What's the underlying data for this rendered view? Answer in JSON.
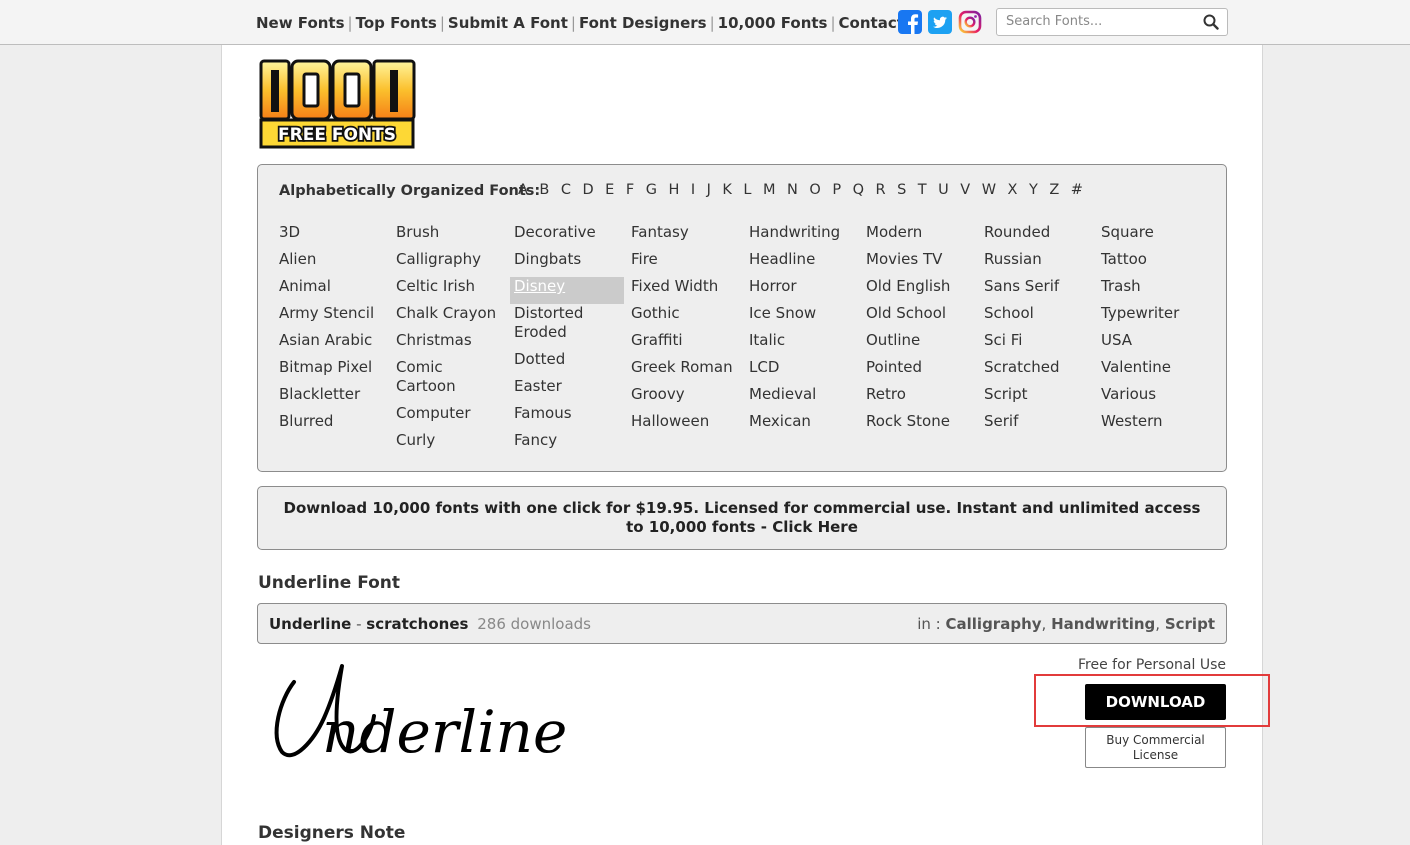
{
  "nav": {
    "links": [
      "New Fonts",
      "Top Fonts",
      "Submit A Font",
      "Font Designers",
      "10,000 Fonts",
      "Contact"
    ]
  },
  "social": {
    "facebook_color": "#1877f2",
    "twitter_color": "#1da1f2",
    "icons": [
      "facebook-icon",
      "twitter-icon",
      "instagram-icon"
    ]
  },
  "search": {
    "placeholder": "Search Fonts..."
  },
  "logo": {
    "top_text": "1001",
    "bottom_text": "FREE FONTS"
  },
  "categories": {
    "title": "Alphabetically Organized Fonts:",
    "letters": [
      "A",
      "B",
      "C",
      "D",
      "E",
      "F",
      "G",
      "H",
      "I",
      "J",
      "K",
      "L",
      "M",
      "N",
      "O",
      "P",
      "Q",
      "R",
      "S",
      "T",
      "U",
      "V",
      "W",
      "X",
      "Y",
      "Z",
      "#"
    ],
    "columns": [
      [
        "3D",
        "Alien",
        "Animal",
        "Army Stencil",
        "Asian Arabic",
        "Bitmap Pixel",
        "Blackletter",
        "Blurred"
      ],
      [
        "Brush",
        "Calligraphy",
        "Celtic Irish",
        "Chalk Crayon",
        "Christmas",
        "Comic Cartoon",
        "Computer",
        "Curly"
      ],
      [
        "Decorative",
        "Dingbats",
        "Disney",
        "Distorted Eroded",
        "Dotted",
        "Easter",
        "Famous",
        "Fancy"
      ],
      [
        "Fantasy",
        "Fire",
        "Fixed Width",
        "Gothic",
        "Graffiti",
        "Greek Roman",
        "Groovy",
        "Halloween"
      ],
      [
        "Handwriting",
        "Headline",
        "Horror",
        "Ice Snow",
        "Italic",
        "LCD",
        "Medieval",
        "Mexican"
      ],
      [
        "Modern",
        "Movies TV",
        "Old English",
        "Old School",
        "Outline",
        "Pointed",
        "Retro",
        "Rock Stone"
      ],
      [
        "Rounded",
        "Russian",
        "Sans Serif",
        "School",
        "Sci Fi",
        "Scratched",
        "Script",
        "Serif"
      ],
      [
        "Square",
        "Tattoo",
        "Trash",
        "Typewriter",
        "USA",
        "Valentine",
        "Various",
        "Western"
      ]
    ],
    "active": "Disney"
  },
  "promo": {
    "text": "Download 10,000 fonts with one click for $19.95. Licensed for commercial use. Instant and unlimited access to 10,000 fonts - Click Here"
  },
  "font": {
    "page_title": "Underline Font",
    "name": "Underline",
    "designer": "scratchones",
    "downloads": "286 downloads",
    "in_label": "in :",
    "tags": [
      "Calligraphy",
      "Handwriting",
      "Script"
    ],
    "preview_text": "Underline",
    "license": "Free for Personal Use",
    "download_label": "DOWNLOAD",
    "buy_label": "Buy Commercial License"
  },
  "designers_note": {
    "title": "Designers Note"
  },
  "colors": {
    "highlight": "#e23b3b",
    "download_bg": "#000000"
  }
}
